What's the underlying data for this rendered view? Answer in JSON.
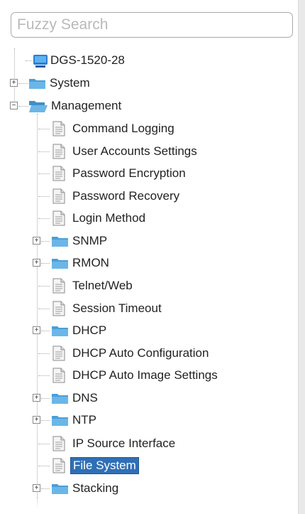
{
  "search": {
    "placeholder": "Fuzzy Search"
  },
  "tree": {
    "root": "DGS-1520-28",
    "system": "System",
    "management": "Management",
    "items": {
      "command_logging": "Command Logging",
      "user_accounts": "User Accounts Settings",
      "password_encryption": "Password Encryption",
      "password_recovery": "Password Recovery",
      "login_method": "Login Method",
      "snmp": "SNMP",
      "rmon": "RMON",
      "telnet_web": "Telnet/Web",
      "session_timeout": "Session Timeout",
      "dhcp": "DHCP",
      "dhcp_auto_config": "DHCP Auto Configuration",
      "dhcp_auto_image": "DHCP Auto Image Settings",
      "dns": "DNS",
      "ntp": "NTP",
      "ip_source_interface": "IP Source Interface",
      "file_system": "File System",
      "stacking": "Stacking"
    },
    "selected": "File System"
  },
  "colors": {
    "selection": "#2f6fb5",
    "folder": "#4a9fd8",
    "page": "#f3f3f3"
  }
}
